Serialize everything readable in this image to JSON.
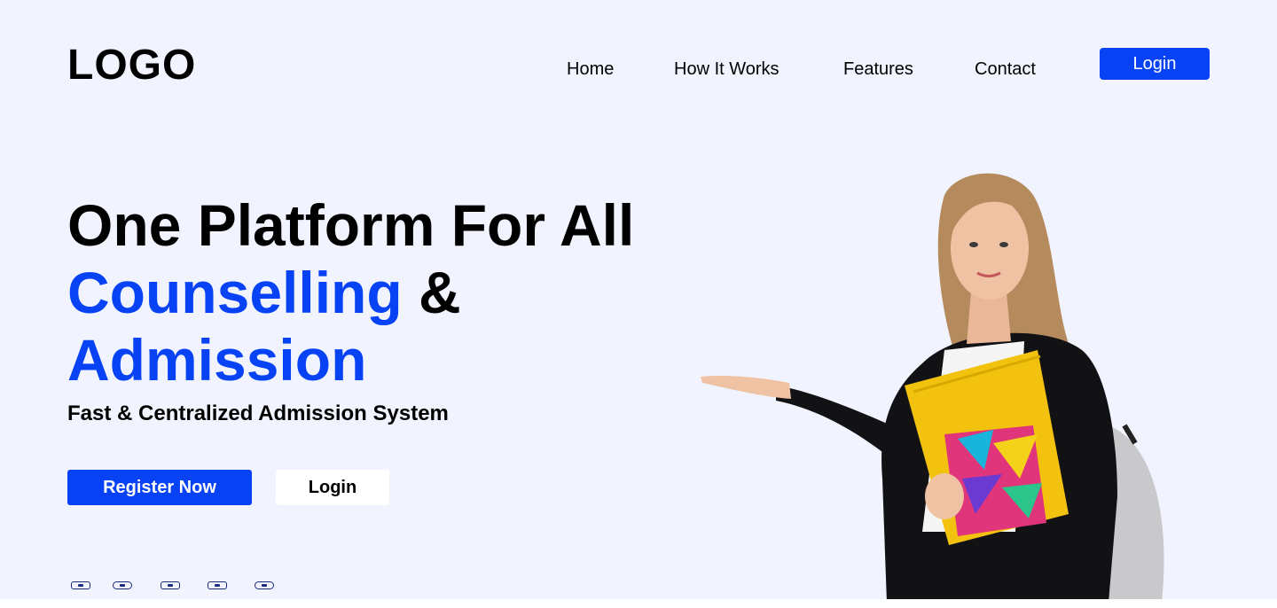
{
  "header": {
    "logo": "LOGO",
    "nav": [
      {
        "label": "Home"
      },
      {
        "label": "How It Works"
      },
      {
        "label": "Features"
      },
      {
        "label": "Contact"
      }
    ],
    "login_label": "Login"
  },
  "hero": {
    "line1": "One Platform For All",
    "line2_accent": "Counselling",
    "line2_rest": " &",
    "line3_accent": "Admission",
    "subtitle": "Fast & Centralized Admission System",
    "register_label": "Register Now",
    "login_label": "Login"
  },
  "social": [
    "linkedin-icon",
    "facebook-icon",
    "instagram-icon",
    "twitter-icon",
    "youtube-icon"
  ],
  "colors": {
    "accent": "#0742f5",
    "background": "#f1f4fe",
    "icon": "#1b2a7a"
  }
}
